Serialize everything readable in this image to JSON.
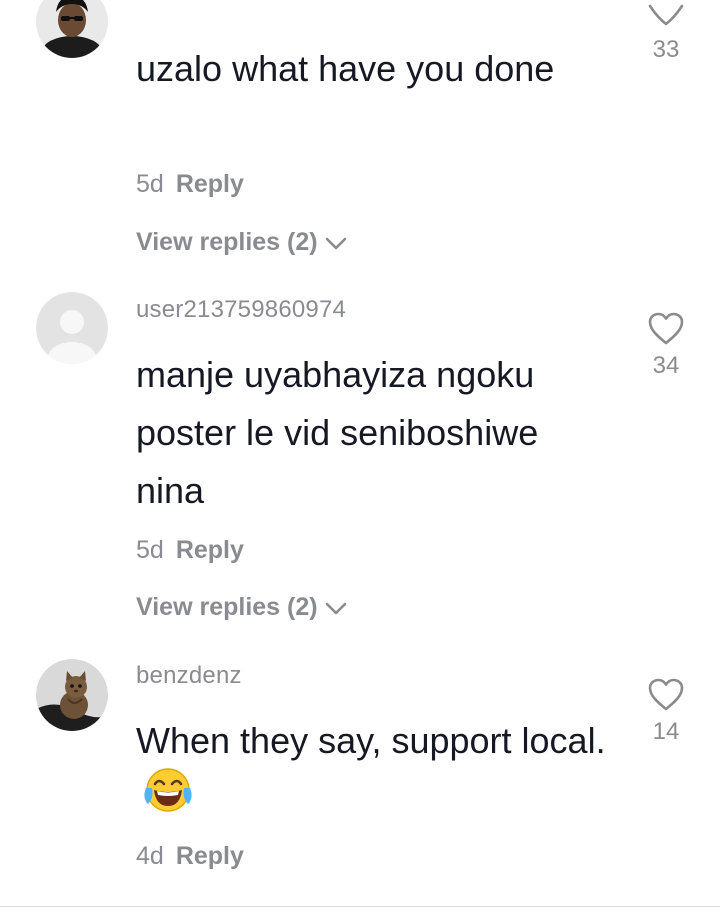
{
  "comments": [
    {
      "username": "",
      "avatar_icon": "man-portrait-avatar",
      "text": "uzalo what have you done",
      "age": "5d",
      "reply_label": "Reply",
      "view_replies": "View replies (2)",
      "likes": "33"
    },
    {
      "username": "user213759860974",
      "avatar_icon": "default-user-avatar",
      "text": "manje uyabhayiza ngoku poster le vid seniboshiwe nina",
      "age": "5d",
      "reply_label": "Reply",
      "view_replies": "View replies (2)",
      "likes": "34"
    },
    {
      "username": "benzdenz",
      "avatar_icon": "kitten-avatar",
      "text": "When they say, support local.",
      "emoji": "face-with-tears-of-joy",
      "age": "4d",
      "reply_label": "Reply",
      "likes": "14"
    }
  ],
  "colors": {
    "text": "#161823",
    "muted": "#8a8b91",
    "background": "#ffffff"
  }
}
